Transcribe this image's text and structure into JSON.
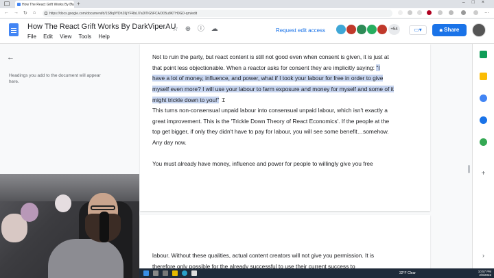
{
  "browser": {
    "tab_title": "How The React Grift Works By Da",
    "url": "https://docs.google.com/document/d/1SBq9YDhZ6jYFRbLl7aDlTiG5FCAOD5u8KTH0GD-qm/edit",
    "new_tab_glyph": "+",
    "tab_close_glyph": "×"
  },
  "docs": {
    "title": "How The React Grift Works By DarkViperAU",
    "menus": [
      "File",
      "Edit",
      "View",
      "Tools",
      "Help"
    ],
    "request_edit": "Request edit access",
    "collaborator_more": "+54",
    "share_label": "Share"
  },
  "outline": {
    "hint": "Headings you add to the document will appear here."
  },
  "document": {
    "p1_lead": "Not to ruin the party, but react content is still not good even when consent is given, it is just at that point less objectionable. When a reactor asks for consent they are implicitly saying: ",
    "p1_quote": "\"I have a lot of money, influence, and power, what if I took your labour for free in order to give myself even more? I will use your labour to farm exposure and money for myself and some of it might trickle down to you!\"",
    "p2": "This turns non-consensual unpaid labour into consensual unpaid labour, which isn't exactly a great improvement. This is the 'Trickle Down Theory of React Economics'. If the people at the top get bigger, if only they didn't have to pay for labour, you will see some benefit…somehow. Any day now.",
    "p3": "You must already have money, influence and power for people to willingly give you free",
    "p4": "labour. Without these qualities, actual content creators will not give you permission. It is therefore only possible for the already successful to use their current success to"
  },
  "taskbar": {
    "weather": "32°F  Clear",
    "time": "10:57 PM",
    "date": "2/9/2022"
  },
  "colors": {
    "accent": "#1a73e8",
    "highlight": "#c6d4ef"
  }
}
